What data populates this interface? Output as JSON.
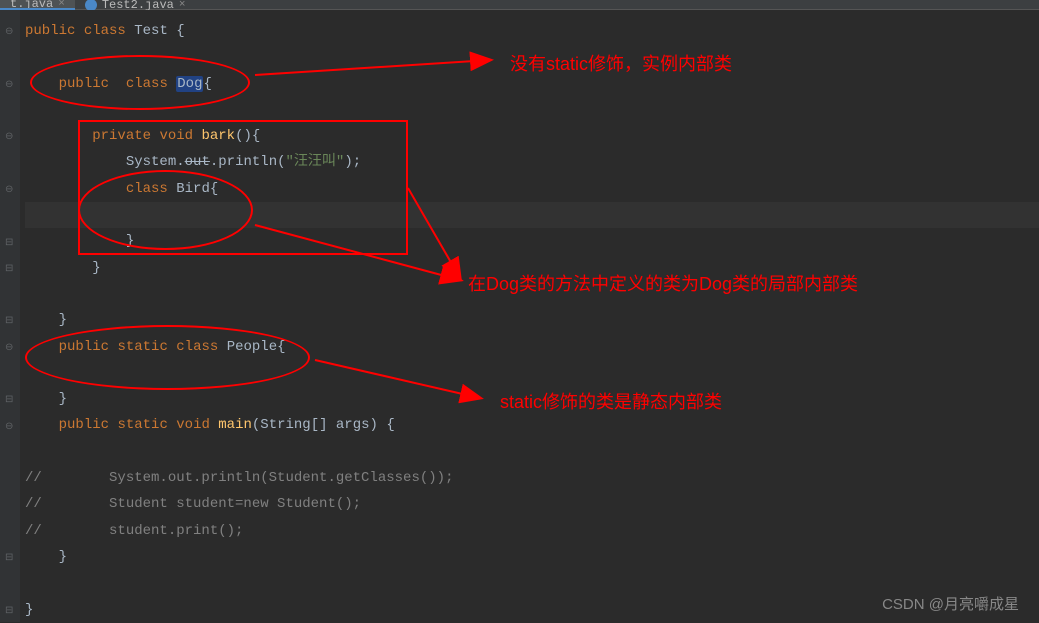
{
  "tabs": [
    {
      "name": "t.java",
      "active": true
    },
    {
      "name": "Test2.java",
      "active": false
    }
  ],
  "code_lines": {
    "l1_kw1": "public",
    "l1_kw2": "class",
    "l1_cls": "Test",
    "l1_brace": " {",
    "l3_kw1": "public",
    "l3_kw2": "class",
    "l3_cls": "Dog",
    "l3_brace": "{",
    "l5_kw1": "private",
    "l5_kw2": "void",
    "l5_method": "bark",
    "l5_rest": "(){",
    "l6_sys": "System",
    "l6_out": "out",
    "l6_println": "println",
    "l6_str": "\"汪汪叫\"",
    "l6_end": ");",
    "l7_kw": "class",
    "l7_cls": "Bird",
    "l7_brace": "{",
    "l9_brace": "}",
    "l10_brace": "}",
    "l12_brace": "}",
    "l13_kw1": "public",
    "l13_kw2": "static",
    "l13_kw3": "class",
    "l13_cls": "People",
    "l13_brace": "{",
    "l15_brace": "}",
    "l16_kw1": "public",
    "l16_kw2": "static",
    "l16_kw3": "void",
    "l16_method": "main",
    "l16_params": "(String[] args) {",
    "l18_cmt": "//        System.out.println(Student.getClasses());",
    "l19_cmt": "//        Student student=new Student();",
    "l20_cmt": "//        student.print();",
    "l21_brace": "}",
    "l23_brace": "}"
  },
  "annotations": {
    "text1": "没有static修饰，实例内部类",
    "text2": "在Dog类的方法中定义的类为Dog类的局部内部类",
    "text3": "static修饰的类是静态内部类"
  },
  "watermark": "CSDN @月亮嚼成星"
}
